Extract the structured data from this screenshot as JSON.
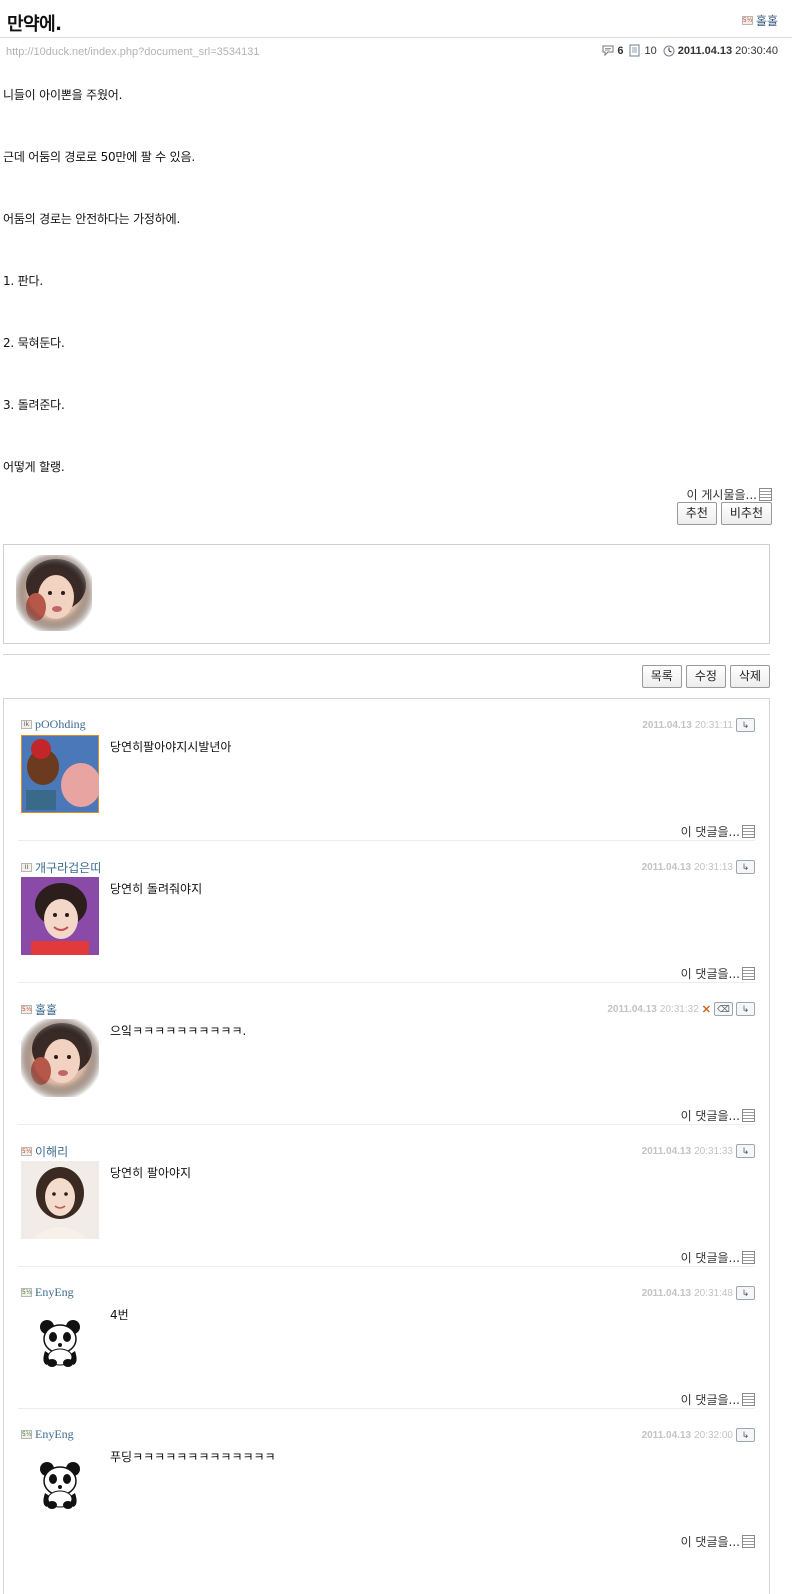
{
  "post": {
    "title": "만약에.",
    "author": "홀홀",
    "author_level": "5½",
    "url": "http://10duck.net/index.php?document_srl=3534131",
    "comment_count": "6",
    "read_count": "10",
    "date": "2011.04.13",
    "time": "20:30:40",
    "body": [
      "니들이 아이뽄을 주웠어.",
      "근데 어둠의 경로로 50만에 팔 수 있음.",
      "어둠의 경로는 안전하다는 가정하에.",
      "1. 판다.",
      "2. 묵혀둔다.",
      "3. 돌려준다.",
      "어떻게 할랭."
    ],
    "this_post_label": "이 게시물을...",
    "recommend_label": "추천",
    "unrecommend_label": "비추천"
  },
  "list_buttons": {
    "list": "목록",
    "edit": "수정",
    "delete": "삭제"
  },
  "comments": [
    {
      "author": "pOOhding",
      "level": "Ik",
      "date": "2011.04.13",
      "time": "20:31:11",
      "text": "당연히팔아야지시발년아",
      "this_label": "이 댓글을..."
    },
    {
      "author": "개구라겁은띠",
      "level": "II",
      "date": "2011.04.13",
      "time": "20:31:13",
      "text": "당연히 돌려줘야지",
      "this_label": "이 댓글을..."
    },
    {
      "author": "홀홀",
      "level": "5½",
      "date": "2011.04.13",
      "time": "20:31:32",
      "text": "으잌ㅋㅋㅋㅋㅋㅋㅋㅋㅋㅋ.",
      "this_label": "이 댓글을..."
    },
    {
      "author": "이해리",
      "level": "5½",
      "date": "2011.04.13",
      "time": "20:31:33",
      "text": "당연히 팔아야지",
      "this_label": "이 댓글을..."
    },
    {
      "author": "EnyEng",
      "level": "5½",
      "date": "2011.04.13",
      "time": "20:31:48",
      "text": "4번",
      "this_label": "이 댓글을..."
    },
    {
      "author": "EnyEng",
      "level": "5½",
      "date": "2011.04.13",
      "time": "20:32:00",
      "text": "푸딩ㅋㅋㅋㅋㅋㅋㅋㅋㅋㅋㅋㅋㅋ",
      "this_label": "이 댓글을..."
    }
  ],
  "icons": {
    "comment": "speech-bubble-icon",
    "read": "document-icon",
    "clock": "clock-icon",
    "reply": "reply-arrow-icon",
    "delete": "delete-x-icon",
    "edit": "eraser-icon"
  }
}
